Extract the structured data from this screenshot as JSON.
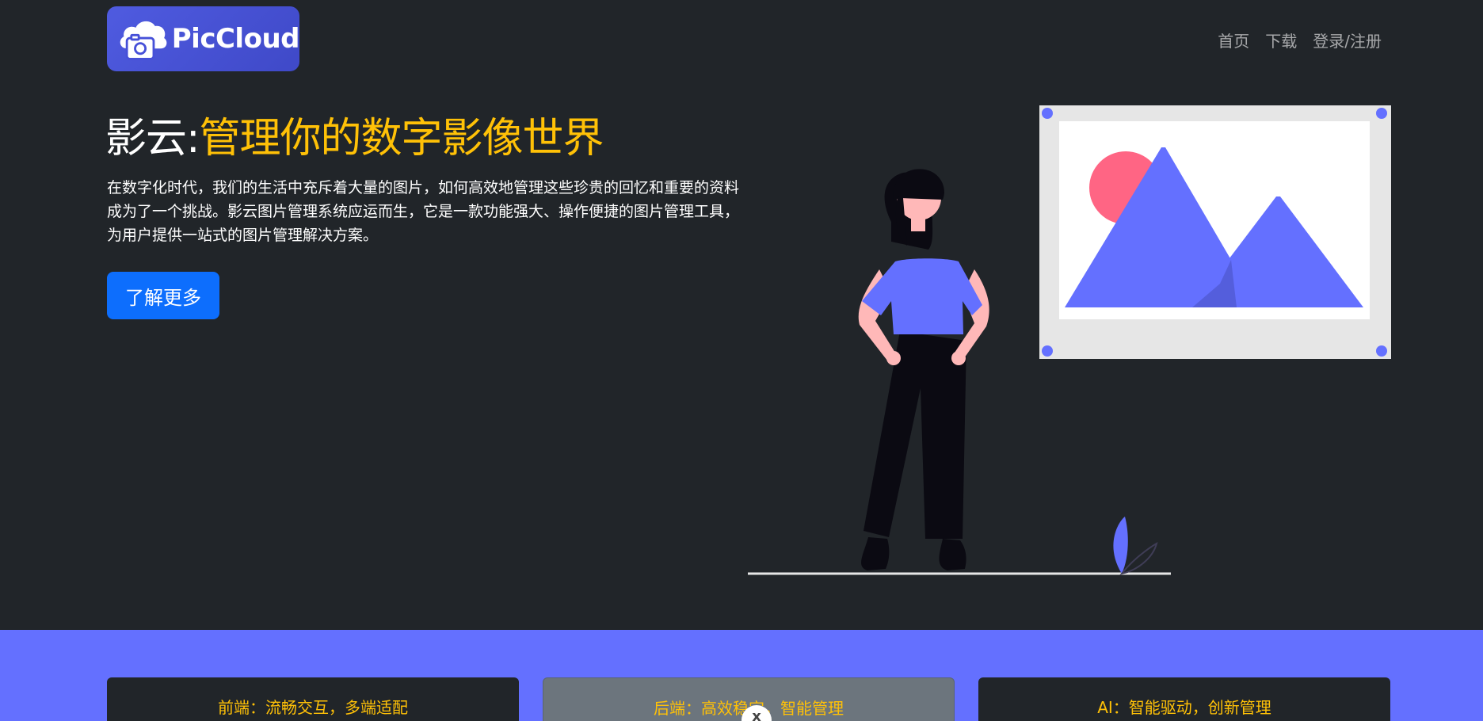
{
  "brand": {
    "logo_text": "PicCloud"
  },
  "nav": {
    "items": [
      {
        "label": "首页"
      },
      {
        "label": "下载"
      },
      {
        "label": "登录/注册"
      }
    ]
  },
  "hero": {
    "title_prefix": "影云:",
    "title_accent": "管理你的数字影像世界",
    "description": "在数字化时代，我们的生活中充斥着大量的图片，如何高效地管理这些珍贵的回忆和重要的资料成为了一个挑战。影云图片管理系统应运而生，它是一款功能强大、操作便捷的图片管理工具，为用户提供一站式的图片管理解决方案。",
    "cta_label": "了解更多"
  },
  "features": {
    "cards": [
      {
        "label": "前端：流畅交互，多端适配"
      },
      {
        "label": "后端：高效稳定，智能管理"
      },
      {
        "label": "AI：智能驱动，创新管理"
      }
    ],
    "close_label": "x"
  },
  "colors": {
    "background": "#212529",
    "accent_yellow": "#ffc107",
    "primary_button": "#0d6efd",
    "illustration_purple": "#6470ff",
    "sun_pink": "#ff6584"
  }
}
